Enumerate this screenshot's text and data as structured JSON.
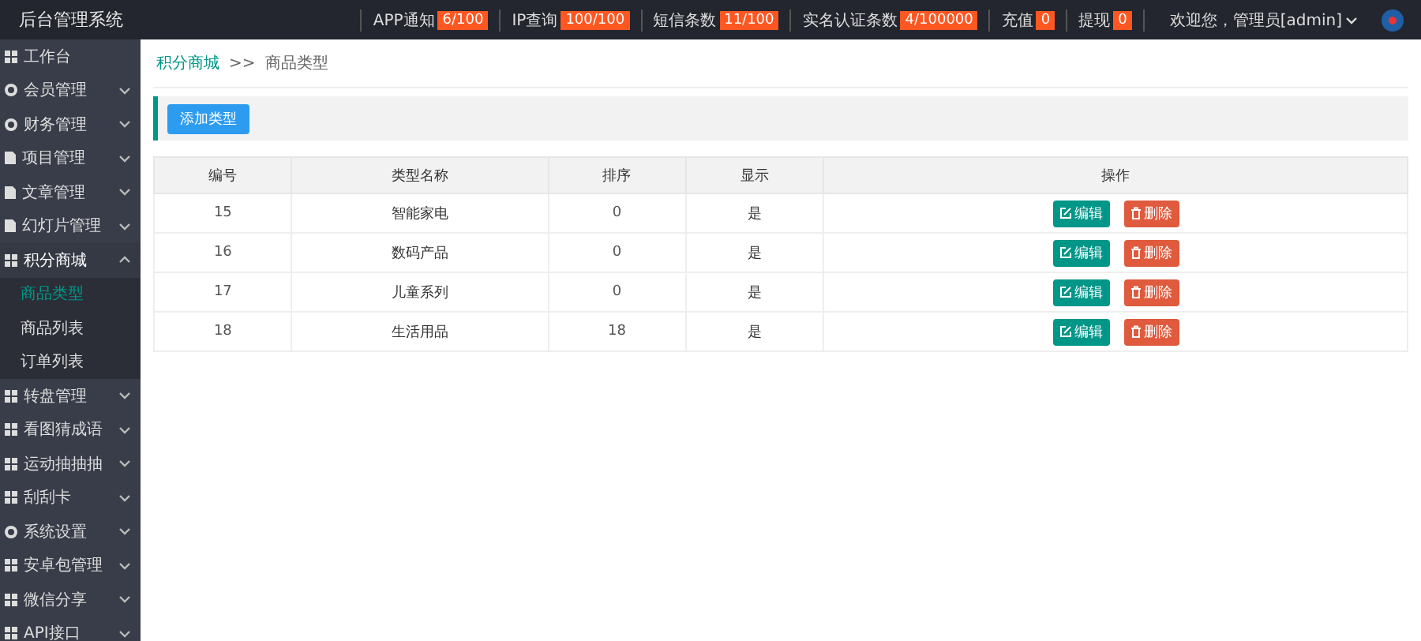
{
  "header": {
    "title": "后台管理系统",
    "stats": [
      {
        "label": "APP通知",
        "badge": "6/100"
      },
      {
        "label": "IP查询",
        "badge": "100/100"
      },
      {
        "label": "短信条数",
        "badge": "11/100"
      },
      {
        "label": "实名认证条数",
        "badge": "4/100000"
      },
      {
        "label": "充值",
        "badge": "0"
      },
      {
        "label": "提现",
        "badge": "0"
      }
    ],
    "user": "欢迎您，管理员[admin]"
  },
  "sidebar": {
    "items": [
      {
        "label": "工作台",
        "kind": "grid"
      },
      {
        "label": "会员管理",
        "kind": "gear",
        "expanded": false
      },
      {
        "label": "财务管理",
        "kind": "gear",
        "expanded": false
      },
      {
        "label": "项目管理",
        "kind": "doc",
        "expanded": false
      },
      {
        "label": "文章管理",
        "kind": "doc",
        "expanded": false
      },
      {
        "label": "幻灯片管理",
        "kind": "doc",
        "expanded": false
      },
      {
        "label": "积分商城",
        "kind": "grid",
        "expanded": true,
        "children": [
          {
            "label": "商品类型",
            "selected": true
          },
          {
            "label": "商品列表",
            "selected": false
          },
          {
            "label": "订单列表",
            "selected": false
          }
        ]
      },
      {
        "label": "转盘管理",
        "kind": "grid",
        "expanded": false
      },
      {
        "label": "看图猜成语",
        "kind": "grid",
        "expanded": false
      },
      {
        "label": "运动抽抽抽",
        "kind": "grid",
        "expanded": false
      },
      {
        "label": "刮刮卡",
        "kind": "grid",
        "expanded": false
      },
      {
        "label": "系统设置",
        "kind": "gear",
        "expanded": false
      },
      {
        "label": "安卓包管理",
        "kind": "grid",
        "expanded": false
      },
      {
        "label": "微信分享",
        "kind": "grid",
        "expanded": false
      },
      {
        "label": "API接口",
        "kind": "grid",
        "expanded": false
      }
    ]
  },
  "breadcrumb": {
    "parent": "积分商城",
    "separator": ">>",
    "current": "商品类型"
  },
  "toolbar": {
    "add_button": "添加类型"
  },
  "table": {
    "columns": [
      "编号",
      "类型名称",
      "排序",
      "显示",
      "操作"
    ],
    "rows": [
      {
        "id": "15",
        "name": "智能家电",
        "sort": "0",
        "visible": "是",
        "edit": "编辑",
        "delete": "删除"
      },
      {
        "id": "16",
        "name": "数码产品",
        "sort": "0",
        "visible": "是",
        "edit": "编辑",
        "delete": "删除"
      },
      {
        "id": "17",
        "name": "儿童系列",
        "sort": "0",
        "visible": "是",
        "edit": "编辑",
        "delete": "删除"
      },
      {
        "id": "18",
        "name": "生活用品",
        "sort": "18",
        "visible": "是",
        "edit": "编辑",
        "delete": "删除"
      }
    ]
  }
}
